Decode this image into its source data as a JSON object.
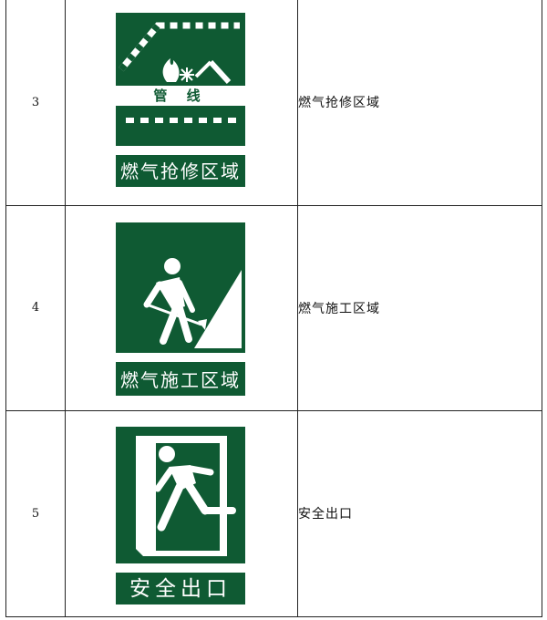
{
  "rows": [
    {
      "number": "3",
      "sign_pipe_label": "管 线",
      "sign_caption": "燃气抢修区域",
      "name": "燃气抢修区域",
      "icon": "gas-repair-sign-icon"
    },
    {
      "number": "4",
      "sign_caption": "燃气施工区域",
      "name": "燃气施工区域",
      "icon": "gas-construction-sign-icon"
    },
    {
      "number": "5",
      "sign_caption": "安全出口",
      "name": "安全出口",
      "icon": "safety-exit-sign-icon"
    }
  ],
  "colors": {
    "sign_green": "#0f5a33",
    "border": "#222222"
  }
}
